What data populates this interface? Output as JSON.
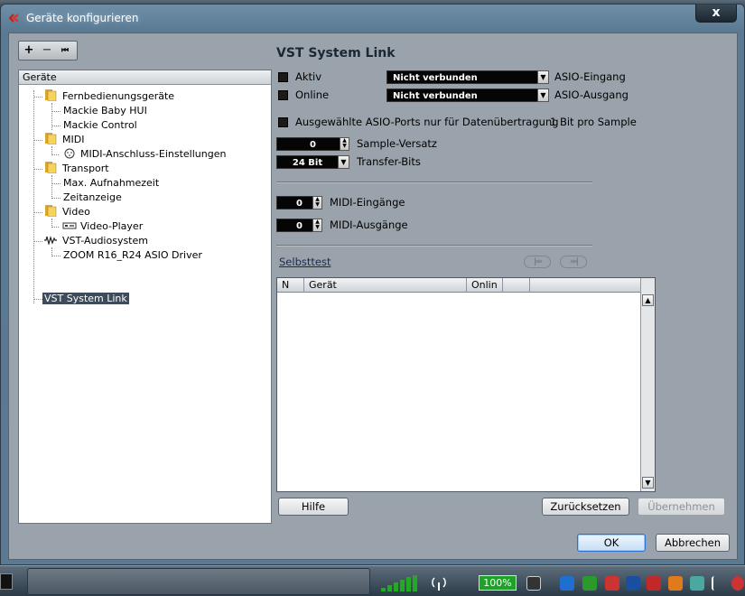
{
  "window": {
    "title": "Geräte konfigurieren",
    "close_label": "x"
  },
  "left": {
    "toolbar": {
      "add": "+",
      "remove": "−",
      "reset": "⏮"
    },
    "tree_header": "Geräte",
    "items": [
      {
        "label": "Fernbedienungsgeräte",
        "type": "folder"
      },
      {
        "label": "Mackie Baby HUI",
        "type": "leaf"
      },
      {
        "label": "Mackie Control",
        "type": "leaf"
      },
      {
        "label": "MIDI",
        "type": "folder"
      },
      {
        "label": "MIDI-Anschluss-Einstellungen",
        "type": "midi"
      },
      {
        "label": "Transport",
        "type": "folder"
      },
      {
        "label": "Max. Aufnahmezeit",
        "type": "leaf"
      },
      {
        "label": "Zeitanzeige",
        "type": "leaf"
      },
      {
        "label": "Video",
        "type": "folder"
      },
      {
        "label": "Video-Player",
        "type": "video"
      },
      {
        "label": "VST-Audiosystem",
        "type": "audio"
      },
      {
        "label": "ZOOM R16_R24 ASIO Driver",
        "type": "leaf"
      },
      {
        "label": "VST System Link",
        "type": "selected"
      }
    ]
  },
  "right": {
    "title": "VST System Link",
    "aktiv_label": "Aktiv",
    "online_label": "Online",
    "aktiv_dropdown": "Nicht verbunden",
    "online_dropdown": "Nicht verbunden",
    "asio_in_label": "ASIO-Eingang",
    "asio_out_label": "ASIO-Ausgang",
    "ports_label": "Ausgewählte ASIO-Ports nur für Datenübertragung",
    "bits_label": "1 Bit pro Sample",
    "sample_offset_value": "0",
    "sample_offset_label": "Sample-Versatz",
    "transfer_bits_value": "24 Bit",
    "transfer_bits_label": "Transfer-Bits",
    "midi_in_value": "0",
    "midi_in_label": "MIDI-Eingänge",
    "midi_out_value": "0",
    "midi_out_label": "MIDI-Ausgänge",
    "selftest_label": "Selbsttest",
    "nav_next": "|»»",
    "nav_last": "»»|",
    "table": {
      "columns": [
        "N",
        "Gerät",
        "Onlin",
        ""
      ]
    }
  },
  "buttons": {
    "help": "Hilfe",
    "reset": "Zurücksetzen",
    "apply": "Übernehmen",
    "ok": "OK",
    "cancel": "Abbrechen"
  },
  "taskbar": {
    "battery": "100%"
  },
  "colors": {
    "selected_bg": "#3d4b5a",
    "folder": "#f0c64a",
    "accent": "#2b6fd1"
  }
}
